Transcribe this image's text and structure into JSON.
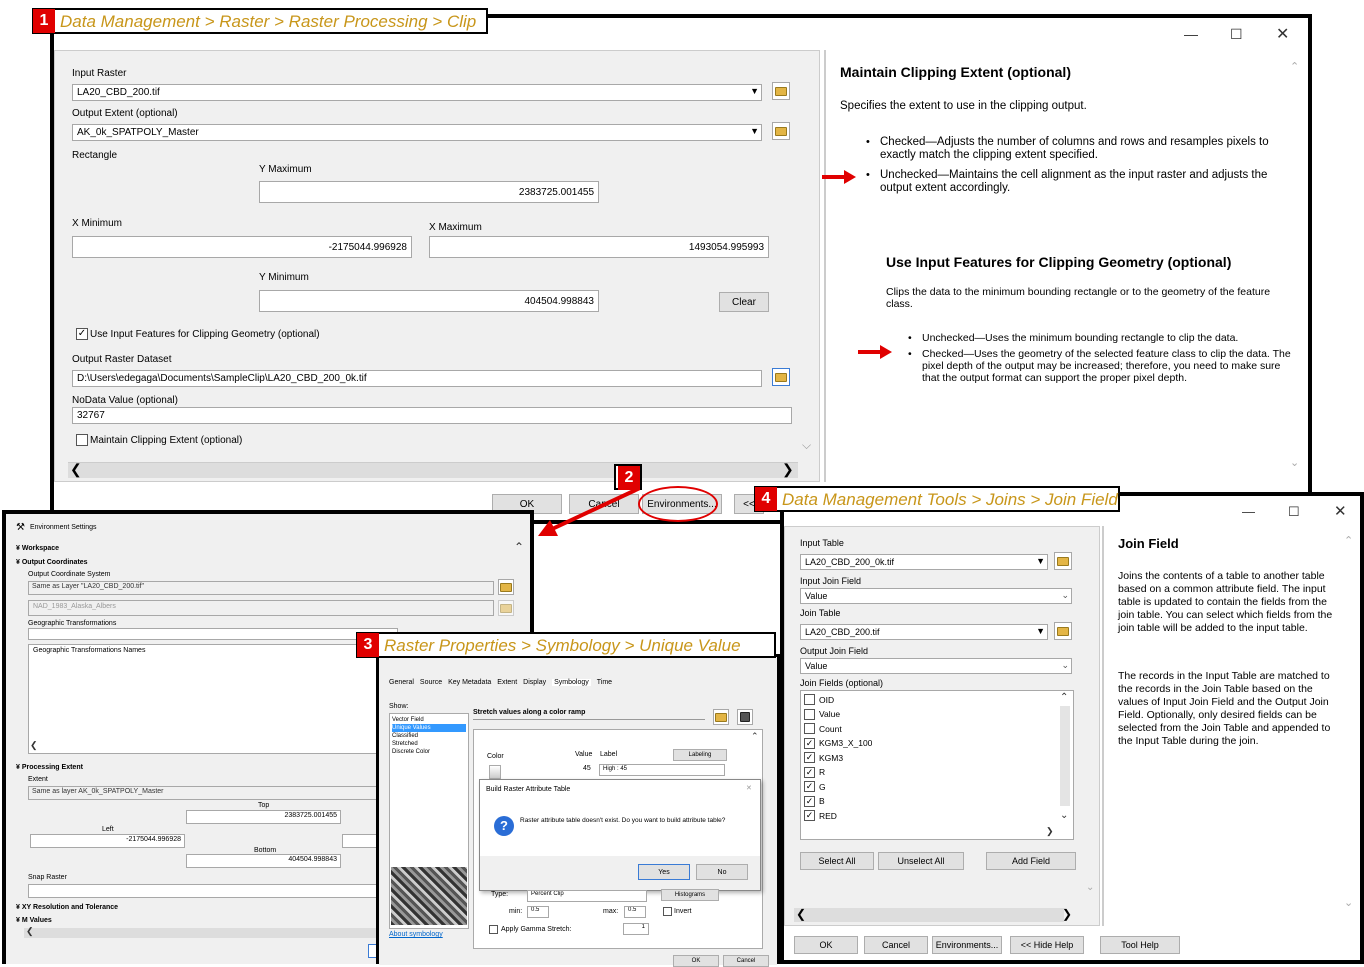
{
  "clip": {
    "header": "Data Management > Raster > Raster Processing > Clip",
    "step": "1",
    "input_raster_label": "Input Raster",
    "input_raster": "LA20_CBD_200.tif",
    "output_extent_label": "Output Extent (optional)",
    "output_extent": "AK_0k_SPATPOLY_Master",
    "rectangle_label": "Rectangle",
    "ymax_label": "Y Maximum",
    "ymax": "2383725.001455",
    "xmin_label": "X Minimum",
    "xmin": "-2175044.996928",
    "xmax_label": "X Maximum",
    "xmax": "1493054.995993",
    "ymin_label": "Y Minimum",
    "ymin": "404504.998843",
    "clear": "Clear",
    "use_input_features": "Use Input Features for Clipping Geometry (optional)",
    "output_raster_label": "Output Raster Dataset",
    "output_raster": "D:\\Users\\edegaga\\Documents\\SampleClip\\LA20_CBD_200_0k.tif",
    "nodata_label": "NoData Value (optional)",
    "nodata": "32767",
    "maintain_extent": "Maintain Clipping Extent (optional)",
    "ok": "OK",
    "cancel": "Cancel",
    "environments": "Environments...",
    "hide": "<<",
    "help": {
      "title1": "Maintain Clipping Extent (optional)",
      "desc1": "Specifies the extent to use in the clipping output.",
      "b1": "Checked—Adjusts the number of columns and rows and resamples pixels to exactly match the clipping extent specified.",
      "b2": "Unchecked—Maintains the cell alignment as the input raster and adjusts the output extent accordingly.",
      "title2": "Use Input Features for Clipping Geometry (optional)",
      "desc2": "Clips the data to the minimum bounding rectangle or to the geometry of the feature class.",
      "b3": "Unchecked—Uses the minimum bounding rectangle to clip the data.",
      "b4": "Checked—Uses the geometry of the selected feature class to clip the data. The pixel depth of the output may be increased; therefore, you need to make sure that the output format can support the proper pixel depth."
    }
  },
  "env": {
    "step": "2",
    "title": "Environment Settings",
    "workspace": "Workspace",
    "output_coords": "Output Coordinates",
    "ocs_label": "Output Coordinate System",
    "ocs": "Same as Layer \"LA20_CBD_200.tif\"",
    "nad": "NAD_1983_Alaska_Albers",
    "geo_trans": "Geographic Transformations",
    "geo_trans_names": "Geographic Transformations Names",
    "proc_extent": "Processing Extent",
    "extent_label": "Extent",
    "extent": "Same as layer AK_0k_SPATPOLY_Master",
    "top_label": "Top",
    "top": "2383725.001455",
    "left_label": "Left",
    "left": "-2175044.996928",
    "bottom_label": "Bottom",
    "bottom": "404504.998843",
    "snap": "Snap Raster",
    "xy": "XY Resolution and Tolerance",
    "m": "M Values"
  },
  "sym": {
    "step": "3",
    "header": "Raster Properties > Symbology > Unique Value",
    "tabs": [
      "General",
      "Source",
      "Key Metadata",
      "Extent",
      "Display",
      "Symbology",
      "Time"
    ],
    "show": "Show:",
    "show_items": [
      "Vector Field",
      "Unique Values",
      "Classified",
      "Stretched",
      "Discrete Color"
    ],
    "stretch": "Stretch values along a color ramp",
    "color": "Color",
    "value": "Value",
    "label": "Label",
    "labeling": "Labeling",
    "val45": "45",
    "high": "High : 45",
    "dialog_title": "Build Raster Attribute Table",
    "dialog_msg": "Raster attribute table doesn't exist. Do you want to build attribute table?",
    "yes": "Yes",
    "no": "No",
    "type_label": "Type:",
    "type": "Percent Clip",
    "histograms": "Histograms",
    "min_label": "min:",
    "min": "0.5",
    "max_label": "max:",
    "max": "0.5",
    "invert": "Invert",
    "gamma": "Apply Gamma Stretch:",
    "gamma_val": "1",
    "about": "About symbology",
    "ok": "OK",
    "cancel": "Cancel"
  },
  "join": {
    "step": "4",
    "header": "Data Management Tools > Joins > Join Field",
    "input_table_label": "Input Table",
    "input_table": "LA20_CBD_200_0k.tif",
    "input_join_label": "Input Join Field",
    "input_join": "Value",
    "join_table_label": "Join Table",
    "join_table": "LA20_CBD_200.tif",
    "output_join_label": "Output Join Field",
    "output_join": "Value",
    "fields_label": "Join Fields (optional)",
    "fields": [
      "OID",
      "Value",
      "Count",
      "KGM3_X_100",
      "KGM3",
      "R",
      "G",
      "B",
      "RED"
    ],
    "checked": [
      false,
      false,
      false,
      true,
      true,
      true,
      true,
      true,
      true
    ],
    "select_all": "Select All",
    "unselect_all": "Unselect All",
    "add_field": "Add Field",
    "ok": "OK",
    "cancel": "Cancel",
    "environments": "Environments...",
    "hide_help": "<< Hide Help",
    "tool_help": "Tool Help",
    "help_title": "Join Field",
    "help1": "Joins the contents of a table to another table based on a common attribute field. The input table is updated to contain the fields from the join table. You can select which fields from the join table will be added to the input table.",
    "help2": "The records in the Input Table are matched to the records in the Join Table based on the values of Input Join Field and the Output Join Field. Optionally, only desired fields can be selected from the Join Table and appended to the Input Table during the join."
  },
  "colors": {
    "header_text": "#c8961a",
    "step_badge": "#e00000",
    "arrow": "#e00000",
    "selection": "#3399ff"
  }
}
